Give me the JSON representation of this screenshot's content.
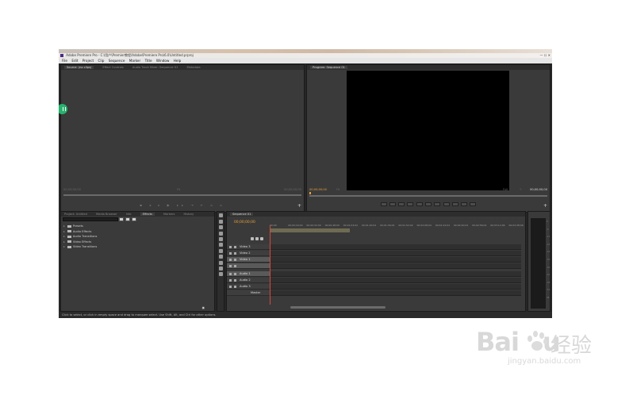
{
  "titlebar": {
    "title": "Adobe Premiere Pro - C:\\用户\\Premier教程\\Adobe\\Premiere Pro\\6.0\\Untitled.prproj"
  },
  "menubar": {
    "items": [
      "File",
      "Edit",
      "Project",
      "Clip",
      "Sequence",
      "Marker",
      "Title",
      "Window",
      "Help"
    ]
  },
  "source_panel": {
    "tabs": [
      "Source: (no clips)",
      "Effect Controls",
      "Audio Track Mixer: Sequence 01",
      "Metadata"
    ],
    "timecode_left": "00;00;00;00",
    "fit": "Fit",
    "timecode_right": "00;00;00;00"
  },
  "program_panel": {
    "tab": "Program: Sequence 01",
    "timecode_left": "00;00;00;00",
    "fit_left": "Fit",
    "fit_right": "Full",
    "timecode_right": "00;00;00;00"
  },
  "project_panel": {
    "tabs": [
      "Project: Untitled",
      "Media Browser",
      "Info",
      "Effects",
      "Markers",
      "History"
    ],
    "active_tab": "Effects",
    "items": [
      "Presets",
      "Audio Effects",
      "Audio Transitions",
      "Video Effects",
      "Video Transitions"
    ]
  },
  "timeline": {
    "tab": "Sequence 01",
    "timecode": "00;00;00;00",
    "ruler": [
      "00;00",
      "00;00;16;00",
      "00;00;32;00",
      "00;00;48;00",
      "00;01;04;02",
      "00;01;20;02",
      "00;01;36;02",
      "00;01;52;02",
      "00;02;08;04",
      "00;02;24;04",
      "00;02;40;04",
      "00;02;56;04",
      "00;03;12;06",
      "00;03;28;06",
      "00;03;44;06",
      "00;04;00;08"
    ],
    "tracks": [
      {
        "name": "Video 3",
        "kind": "video",
        "selected": false
      },
      {
        "name": "Video 2",
        "kind": "video",
        "selected": false
      },
      {
        "name": "Video 1",
        "kind": "video",
        "selected": true
      },
      {
        "name": "",
        "kind": "spacer",
        "selected": true
      },
      {
        "name": "Audio 1",
        "kind": "audio",
        "selected": true
      },
      {
        "name": "Audio 2",
        "kind": "audio",
        "selected": false
      },
      {
        "name": "Audio 3",
        "kind": "audio",
        "selected": false
      },
      {
        "name": "Master",
        "kind": "master",
        "selected": false
      }
    ]
  },
  "meter": {
    "scale": [
      "0",
      "-6",
      "-12",
      "-18",
      "-24",
      "-30",
      "-36",
      "-42",
      "-48",
      "-54",
      "dB"
    ]
  },
  "statusbar": {
    "text": "Click to select, or click in empty space and drag to marquee select. Use Shift, Alt, and Ctrl for other options."
  },
  "watermark": {
    "logo_text": "Bai",
    "logo_tail": "u",
    "cn_text": "经验",
    "url": "jingyan.baidu.com"
  }
}
